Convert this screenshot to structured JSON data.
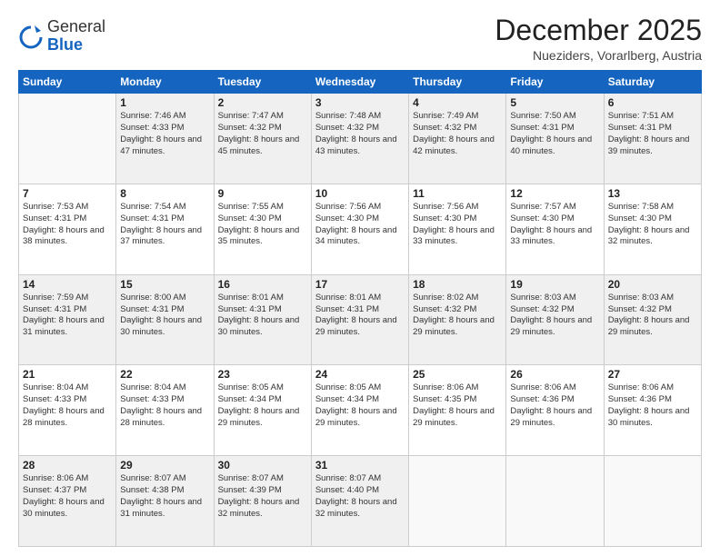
{
  "header": {
    "logo_general": "General",
    "logo_blue": "Blue",
    "month": "December 2025",
    "location": "Nueziders, Vorarlberg, Austria"
  },
  "weekdays": [
    "Sunday",
    "Monday",
    "Tuesday",
    "Wednesday",
    "Thursday",
    "Friday",
    "Saturday"
  ],
  "weeks": [
    [
      {
        "day": "",
        "content": ""
      },
      {
        "day": "1",
        "content": "Sunrise: 7:46 AM\nSunset: 4:33 PM\nDaylight: 8 hours\nand 47 minutes."
      },
      {
        "day": "2",
        "content": "Sunrise: 7:47 AM\nSunset: 4:32 PM\nDaylight: 8 hours\nand 45 minutes."
      },
      {
        "day": "3",
        "content": "Sunrise: 7:48 AM\nSunset: 4:32 PM\nDaylight: 8 hours\nand 43 minutes."
      },
      {
        "day": "4",
        "content": "Sunrise: 7:49 AM\nSunset: 4:32 PM\nDaylight: 8 hours\nand 42 minutes."
      },
      {
        "day": "5",
        "content": "Sunrise: 7:50 AM\nSunset: 4:31 PM\nDaylight: 8 hours\nand 40 minutes."
      },
      {
        "day": "6",
        "content": "Sunrise: 7:51 AM\nSunset: 4:31 PM\nDaylight: 8 hours\nand 39 minutes."
      }
    ],
    [
      {
        "day": "7",
        "content": "Sunrise: 7:53 AM\nSunset: 4:31 PM\nDaylight: 8 hours\nand 38 minutes."
      },
      {
        "day": "8",
        "content": "Sunrise: 7:54 AM\nSunset: 4:31 PM\nDaylight: 8 hours\nand 37 minutes."
      },
      {
        "day": "9",
        "content": "Sunrise: 7:55 AM\nSunset: 4:30 PM\nDaylight: 8 hours\nand 35 minutes."
      },
      {
        "day": "10",
        "content": "Sunrise: 7:56 AM\nSunset: 4:30 PM\nDaylight: 8 hours\nand 34 minutes."
      },
      {
        "day": "11",
        "content": "Sunrise: 7:56 AM\nSunset: 4:30 PM\nDaylight: 8 hours\nand 33 minutes."
      },
      {
        "day": "12",
        "content": "Sunrise: 7:57 AM\nSunset: 4:30 PM\nDaylight: 8 hours\nand 33 minutes."
      },
      {
        "day": "13",
        "content": "Sunrise: 7:58 AM\nSunset: 4:30 PM\nDaylight: 8 hours\nand 32 minutes."
      }
    ],
    [
      {
        "day": "14",
        "content": "Sunrise: 7:59 AM\nSunset: 4:31 PM\nDaylight: 8 hours\nand 31 minutes."
      },
      {
        "day": "15",
        "content": "Sunrise: 8:00 AM\nSunset: 4:31 PM\nDaylight: 8 hours\nand 30 minutes."
      },
      {
        "day": "16",
        "content": "Sunrise: 8:01 AM\nSunset: 4:31 PM\nDaylight: 8 hours\nand 30 minutes."
      },
      {
        "day": "17",
        "content": "Sunrise: 8:01 AM\nSunset: 4:31 PM\nDaylight: 8 hours\nand 29 minutes."
      },
      {
        "day": "18",
        "content": "Sunrise: 8:02 AM\nSunset: 4:32 PM\nDaylight: 8 hours\nand 29 minutes."
      },
      {
        "day": "19",
        "content": "Sunrise: 8:03 AM\nSunset: 4:32 PM\nDaylight: 8 hours\nand 29 minutes."
      },
      {
        "day": "20",
        "content": "Sunrise: 8:03 AM\nSunset: 4:32 PM\nDaylight: 8 hours\nand 29 minutes."
      }
    ],
    [
      {
        "day": "21",
        "content": "Sunrise: 8:04 AM\nSunset: 4:33 PM\nDaylight: 8 hours\nand 28 minutes."
      },
      {
        "day": "22",
        "content": "Sunrise: 8:04 AM\nSunset: 4:33 PM\nDaylight: 8 hours\nand 28 minutes."
      },
      {
        "day": "23",
        "content": "Sunrise: 8:05 AM\nSunset: 4:34 PM\nDaylight: 8 hours\nand 29 minutes."
      },
      {
        "day": "24",
        "content": "Sunrise: 8:05 AM\nSunset: 4:34 PM\nDaylight: 8 hours\nand 29 minutes."
      },
      {
        "day": "25",
        "content": "Sunrise: 8:06 AM\nSunset: 4:35 PM\nDaylight: 8 hours\nand 29 minutes."
      },
      {
        "day": "26",
        "content": "Sunrise: 8:06 AM\nSunset: 4:36 PM\nDaylight: 8 hours\nand 29 minutes."
      },
      {
        "day": "27",
        "content": "Sunrise: 8:06 AM\nSunset: 4:36 PM\nDaylight: 8 hours\nand 30 minutes."
      }
    ],
    [
      {
        "day": "28",
        "content": "Sunrise: 8:06 AM\nSunset: 4:37 PM\nDaylight: 8 hours\nand 30 minutes."
      },
      {
        "day": "29",
        "content": "Sunrise: 8:07 AM\nSunset: 4:38 PM\nDaylight: 8 hours\nand 31 minutes."
      },
      {
        "day": "30",
        "content": "Sunrise: 8:07 AM\nSunset: 4:39 PM\nDaylight: 8 hours\nand 32 minutes."
      },
      {
        "day": "31",
        "content": "Sunrise: 8:07 AM\nSunset: 4:40 PM\nDaylight: 8 hours\nand 32 minutes."
      },
      {
        "day": "",
        "content": ""
      },
      {
        "day": "",
        "content": ""
      },
      {
        "day": "",
        "content": ""
      }
    ]
  ]
}
